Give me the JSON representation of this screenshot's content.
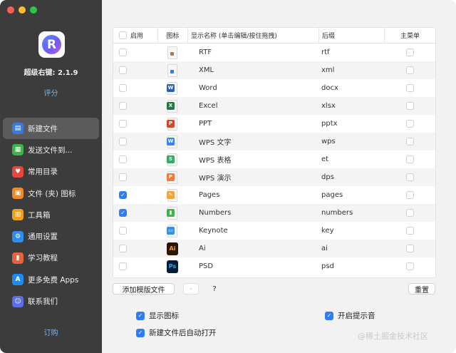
{
  "app": {
    "name": "超级右键: 2.1.9",
    "rate_label": "评分",
    "subscribe_label": "订购"
  },
  "sidebar": {
    "items": [
      {
        "label": "新建文件",
        "icon": "new-file-icon",
        "color": "#3a7be0",
        "active": true
      },
      {
        "label": "发送文件到...",
        "icon": "send-file-icon",
        "color": "#3bb54a"
      },
      {
        "label": "常用目录",
        "icon": "heart-icon",
        "color": "#e8453c"
      },
      {
        "label": "文件 (夹) 图标",
        "icon": "folder-icon-icon",
        "color": "#f08a24"
      },
      {
        "label": "工具箱",
        "icon": "toolbox-icon",
        "color": "#f0a020"
      },
      {
        "label": "通用设置",
        "icon": "gear-icon",
        "color": "#2f8ff0"
      },
      {
        "label": "学习教程",
        "icon": "book-icon",
        "color": "#e8633c"
      },
      {
        "label": "更多免费 Apps",
        "icon": "app-store-icon",
        "color": "#1e8bf5"
      },
      {
        "label": "联系我们",
        "icon": "contact-icon",
        "color": "#5b6ee8"
      }
    ]
  },
  "table": {
    "headers": {
      "enabled": "启用",
      "icon": "图标",
      "name": "显示名称 (单击编辑/按住拖拽)",
      "suffix": "后缀",
      "main_menu": "主菜单"
    },
    "rows": [
      {
        "name": "RTF",
        "suffix": "rtf",
        "enabled": false,
        "icon": "rtf-file-icon"
      },
      {
        "name": "XML",
        "suffix": "xml",
        "enabled": false,
        "icon": "xml-file-icon"
      },
      {
        "name": "Word",
        "suffix": "docx",
        "enabled": false,
        "icon": "word-icon"
      },
      {
        "name": "Excel",
        "suffix": "xlsx",
        "enabled": false,
        "icon": "excel-icon"
      },
      {
        "name": "PPT",
        "suffix": "pptx",
        "enabled": false,
        "icon": "powerpoint-icon"
      },
      {
        "name": "WPS 文字",
        "suffix": "wps",
        "enabled": false,
        "icon": "wps-writer-icon"
      },
      {
        "name": "WPS 表格",
        "suffix": "et",
        "enabled": false,
        "icon": "wps-spreadsheet-icon"
      },
      {
        "name": "WPS 演示",
        "suffix": "dps",
        "enabled": false,
        "icon": "wps-presentation-icon"
      },
      {
        "name": "Pages",
        "suffix": "pages",
        "enabled": true,
        "icon": "pages-icon"
      },
      {
        "name": "Numbers",
        "suffix": "numbers",
        "enabled": true,
        "icon": "numbers-icon"
      },
      {
        "name": "Keynote",
        "suffix": "key",
        "enabled": false,
        "icon": "keynote-icon"
      },
      {
        "name": "Ai",
        "suffix": "ai",
        "enabled": false,
        "icon": "illustrator-icon"
      },
      {
        "name": "PSD",
        "suffix": "psd",
        "enabled": false,
        "icon": "photoshop-icon"
      }
    ]
  },
  "buttons": {
    "add_template": "添加模版文件",
    "remove": "-",
    "help": "?",
    "reset": "重置"
  },
  "options": {
    "show_icon": {
      "label": "显示图标",
      "checked": true
    },
    "auto_open": {
      "label": "新建文件后自动打开",
      "checked": true
    },
    "sound": {
      "label": "开启提示音",
      "checked": true
    }
  },
  "watermark": "@稀土掘金技术社区"
}
